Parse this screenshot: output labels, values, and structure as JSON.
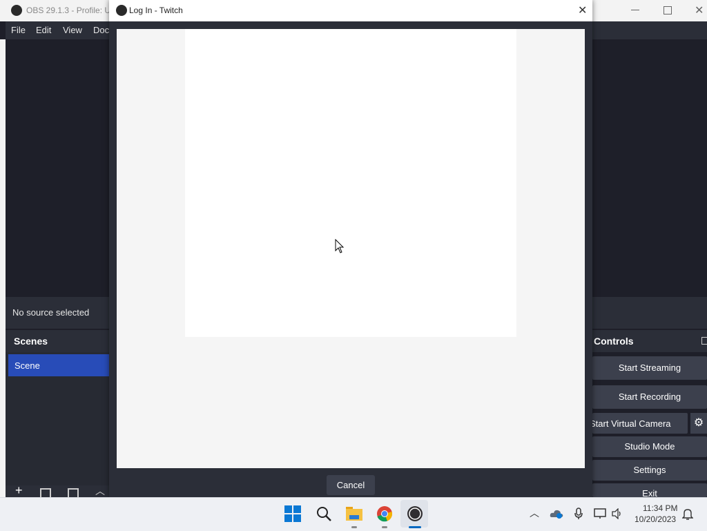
{
  "obs": {
    "title": "OBS 29.1.3 - Profile: Ur",
    "menu": [
      "File",
      "Edit",
      "View",
      "Doc"
    ],
    "source_status": "No source selected",
    "scenes_label": "Scenes",
    "scene_item": "Scene",
    "controls_label": "Controls",
    "controls": {
      "start_streaming": "Start Streaming",
      "start_recording": "Start Recording",
      "start_virtual_camera": "Start Virtual Camera",
      "studio_mode": "Studio Mode",
      "settings": "Settings",
      "exit": "Exit"
    }
  },
  "dialog": {
    "title": "Log In - Twitch",
    "cancel_label": "Cancel"
  },
  "taskbar": {
    "time": "11:34 PM",
    "date": "10/20/2023"
  }
}
